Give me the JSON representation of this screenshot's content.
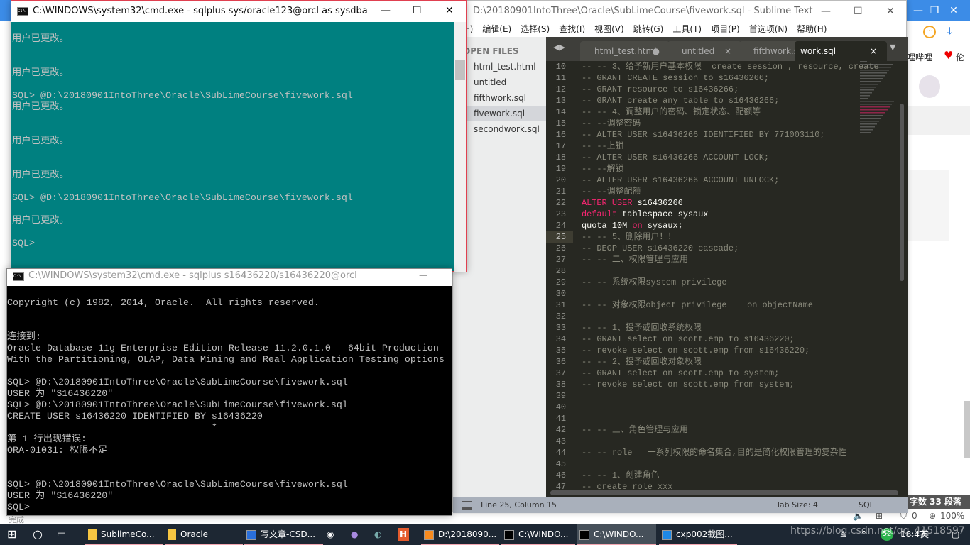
{
  "browser": {
    "right_text": "哩哔哩",
    "heart_label": "伦",
    "status_dark": "字数 33 段落",
    "status_icons": [
      "speaker-icon",
      "extension-icon",
      "adblock-icon"
    ],
    "adblock_count": "0",
    "zoom": "100%",
    "done": "完成"
  },
  "sublime": {
    "title": "D:\\20180901IntoThree\\Oracle\\SubLimeCourse\\fivework.sql - Sublime Text",
    "menu": [
      "件(F)",
      "编辑(E)",
      "选择(S)",
      "查找(I)",
      "视图(V)",
      "跳转(G)",
      "工具(T)",
      "项目(P)",
      "首选项(N)",
      "帮助(H)"
    ],
    "sidebar_header": "OPEN FILES",
    "files": [
      "html_test.html",
      "untitled",
      "fifthwork.sql",
      "fivework.sql",
      "secondwork.sql"
    ],
    "active_file": "fivework.sql",
    "tabs": [
      {
        "label": "html_test.html",
        "mark": "●"
      },
      {
        "label": "untitled",
        "mark": "×"
      },
      {
        "label": "fifthwork.sql",
        "mark": "×"
      },
      {
        "label": "work.sql",
        "mark": "×"
      }
    ],
    "current_line": 25,
    "code": [
      {
        "n": "10",
        "s": [
          {
            "c": "cm",
            "t": "-- -- 3、给予新用户基本权限  create session , resource, create"
          }
        ]
      },
      {
        "n": "11",
        "s": [
          {
            "c": "cm",
            "t": "-- GRANT CREATE session to s16436266;"
          }
        ]
      },
      {
        "n": "12",
        "s": [
          {
            "c": "cm",
            "t": "-- GRANT resource to s16436266;"
          }
        ]
      },
      {
        "n": "13",
        "s": [
          {
            "c": "cm",
            "t": "-- GRANT create any table to s16436266;"
          }
        ]
      },
      {
        "n": "14",
        "s": [
          {
            "c": "cm",
            "t": "-- -- 4、调整用户的密码、锁定状态、配额等"
          }
        ]
      },
      {
        "n": "15",
        "s": [
          {
            "c": "cm",
            "t": "-- --调整密码"
          }
        ]
      },
      {
        "n": "16",
        "s": [
          {
            "c": "cm",
            "t": "-- ALTER USER s16436266 IDENTIFIED BY 771003110;"
          }
        ]
      },
      {
        "n": "17",
        "s": [
          {
            "c": "cm",
            "t": "-- --上锁"
          }
        ]
      },
      {
        "n": "18",
        "s": [
          {
            "c": "cm",
            "t": "-- ALTER USER s16436266 ACCOUNT LOCK;"
          }
        ]
      },
      {
        "n": "19",
        "s": [
          {
            "c": "cm",
            "t": "-- --解锁"
          }
        ]
      },
      {
        "n": "20",
        "s": [
          {
            "c": "cm",
            "t": "-- ALTER USER s16436266 ACCOUNT UNLOCK;"
          }
        ]
      },
      {
        "n": "21",
        "s": [
          {
            "c": "cm",
            "t": "-- --调整配额"
          }
        ]
      },
      {
        "n": "22",
        "s": [
          {
            "c": "kw",
            "t": "ALTER USER"
          },
          {
            "c": "tx",
            "t": " s16436266"
          }
        ]
      },
      {
        "n": "23",
        "s": [
          {
            "c": "kw",
            "t": "default"
          },
          {
            "c": "tx",
            "t": " tablespace sysaux"
          }
        ]
      },
      {
        "n": "24",
        "s": [
          {
            "c": "tx",
            "t": "quota 10M "
          },
          {
            "c": "kw",
            "t": "on"
          },
          {
            "c": "tx",
            "t": " sysaux;"
          }
        ]
      },
      {
        "n": "25",
        "s": [
          {
            "c": "cm",
            "t": "-- -- 5、删除用户！！"
          }
        ]
      },
      {
        "n": "26",
        "s": [
          {
            "c": "cm",
            "t": "-- DEOP USER s16436220 cascade;"
          }
        ]
      },
      {
        "n": "27",
        "s": [
          {
            "c": "cm",
            "t": "-- -- 二、权限管理与应用"
          }
        ]
      },
      {
        "n": "28",
        "s": []
      },
      {
        "n": "29",
        "s": [
          {
            "c": "cm",
            "t": "-- -- 系统权限system privilege"
          }
        ]
      },
      {
        "n": "30",
        "s": []
      },
      {
        "n": "31",
        "s": [
          {
            "c": "cm",
            "t": "-- -- 对象权限object privilege    on objectName"
          }
        ]
      },
      {
        "n": "32",
        "s": []
      },
      {
        "n": "33",
        "s": [
          {
            "c": "cm",
            "t": "-- -- 1、授予或回收系统权限"
          }
        ]
      },
      {
        "n": "34",
        "s": [
          {
            "c": "cm",
            "t": "-- GRANT select on scott.emp to s16436220;"
          }
        ]
      },
      {
        "n": "35",
        "s": [
          {
            "c": "cm",
            "t": "-- revoke select on scott.emp from s16436220;"
          }
        ]
      },
      {
        "n": "36",
        "s": [
          {
            "c": "cm",
            "t": "-- -- 2、授予或回收对象权限"
          }
        ]
      },
      {
        "n": "37",
        "s": [
          {
            "c": "cm",
            "t": "-- GRANT select on scott.emp to system;"
          }
        ]
      },
      {
        "n": "38",
        "s": [
          {
            "c": "cm",
            "t": "-- revoke select on scott.emp from system;"
          }
        ]
      },
      {
        "n": "39",
        "s": []
      },
      {
        "n": "40",
        "s": []
      },
      {
        "n": "41",
        "s": []
      },
      {
        "n": "42",
        "s": [
          {
            "c": "cm",
            "t": "-- -- 三、角色管理与应用"
          }
        ]
      },
      {
        "n": "43",
        "s": []
      },
      {
        "n": "44",
        "s": [
          {
            "c": "cm",
            "t": "-- -- role   一系列权限的命名集合,目的是简化权限管理的复杂性"
          }
        ]
      },
      {
        "n": "45",
        "s": []
      },
      {
        "n": "46",
        "s": [
          {
            "c": "cm",
            "t": "-- -- 1、创建角色"
          }
        ]
      },
      {
        "n": "47",
        "s": [
          {
            "c": "cm",
            "t": "-- create role xxx"
          }
        ]
      }
    ],
    "status": {
      "position": "Line 25, Column 15",
      "tab_size": "Tab Size: 4",
      "syntax": "SQL"
    }
  },
  "cmd1": {
    "title": "C:\\WINDOWS\\system32\\cmd.exe - sqlplus  sys/oracle123@orcl as sysdba",
    "lines": [
      "用户已更改。",
      "",
      "",
      "用户已更改。",
      "",
      "SQL> @D:\\20180901IntoThree\\Oracle\\SubLimeCourse\\fivework.sql",
      "用户已更改。",
      "",
      "",
      "用户已更改。",
      "",
      "",
      "用户已更改。",
      "",
      "SQL> @D:\\20180901IntoThree\\Oracle\\SubLimeCourse\\fivework.sql",
      "",
      "用户已更改。",
      "",
      "SQL>"
    ]
  },
  "cmd2": {
    "title": "C:\\WINDOWS\\system32\\cmd.exe - sqlplus  s16436220/s16436220@orcl",
    "lines": [
      "",
      "Copyright (c) 1982, 2014, Oracle.  All rights reserved.",
      "",
      "",
      "连接到:",
      "Oracle Database 11g Enterprise Edition Release 11.2.0.1.0 - 64bit Production",
      "With the Partitioning, OLAP, Data Mining and Real Application Testing options",
      "",
      "SQL> @D:\\20180901IntoThree\\Oracle\\SubLimeCourse\\fivework.sql",
      "USER 为 \"S16436220\"",
      "SQL> @D:\\20180901IntoThree\\Oracle\\SubLimeCourse\\fivework.sql",
      "CREATE USER s16436220 IDENTIFIED BY s16436220",
      "                                    *",
      "第 1 行出现错误:",
      "ORA-01031: 权限不足",
      "",
      "",
      "SQL> @D:\\20180901IntoThree\\Oracle\\SubLimeCourse\\fivework.sql",
      "USER 为 \"S16436220\"",
      "SQL>"
    ]
  },
  "taskbar": {
    "items": [
      {
        "label": "SublimeCo...",
        "icon": "folder-icon"
      },
      {
        "label": "Oracle",
        "icon": "folder-icon"
      },
      {
        "label": "写文章-CSD...",
        "icon": "browser-icon"
      },
      {
        "label": "D:\\2018090...",
        "icon": "sublime-icon"
      },
      {
        "label": "C:\\WINDO...",
        "icon": "cmd-icon"
      },
      {
        "label": "C:\\WINDO...",
        "icon": "cmd-icon"
      },
      {
        "label": "cxp002截图...",
        "icon": "app-icon"
      }
    ],
    "ime": "英",
    "badge": "52",
    "time": "18:47",
    "watermark": "https://blog.csdn.net/qq_41518597"
  },
  "colors": {
    "cmd_teal": "#008080",
    "editor_bg": "#272822",
    "keyword": "#f92672",
    "taskbar": "#1d2733"
  }
}
